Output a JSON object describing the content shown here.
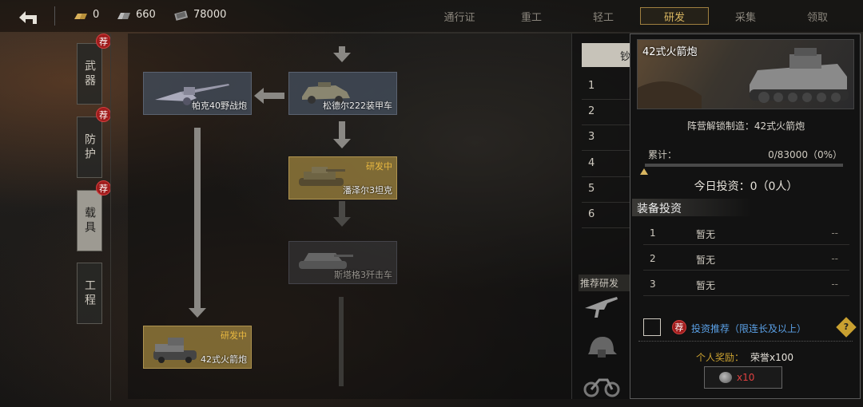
{
  "topbar": {
    "resources": [
      {
        "icon": "gold-bars-icon",
        "value": "0"
      },
      {
        "icon": "steel-icon",
        "value": "660"
      },
      {
        "icon": "cash-icon",
        "value": "78000"
      }
    ],
    "tabs": [
      "通行证",
      "重工",
      "轻工",
      "研发",
      "采集",
      "领取"
    ],
    "active_tab": "研发"
  },
  "categories": [
    {
      "label": "武器",
      "badge": "荐",
      "active": false
    },
    {
      "label": "防护",
      "badge": "荐",
      "active": false
    },
    {
      "label": "载具",
      "badge": "荐",
      "active": true
    },
    {
      "label": "工程",
      "badge": "",
      "active": false
    }
  ],
  "tree": {
    "nodes": [
      {
        "id": "pak40",
        "label": "帕克40野战炮",
        "status": ""
      },
      {
        "id": "sdkfz222",
        "label": "松德尔222装甲车",
        "status": ""
      },
      {
        "id": "panzer3",
        "label": "潘泽尔3坦克",
        "status": "研发中"
      },
      {
        "id": "stug3",
        "label": "斯塔格3歼击车",
        "status": ""
      },
      {
        "id": "nebelwerfer42",
        "label": "42式火箭炮",
        "status": "研发中"
      }
    ]
  },
  "list_panel": {
    "button_label": "钞",
    "rows": [
      "1",
      "2",
      "3",
      "4",
      "5",
      "6"
    ],
    "recommend_title": "推荐研发",
    "recommend_items": [
      "smg-icon",
      "helmet-icon",
      "motorcycle-icon"
    ]
  },
  "detail": {
    "title": "42式火箭炮",
    "unlock_text": "阵营解锁制造：42式火箭炮",
    "accum_label": "累计：",
    "accum_value": "0/83000（0%）",
    "progress_fraction": 0,
    "today_invest": "今日投资：0（0人）",
    "section_title": "装备投资",
    "invest_rows": [
      {
        "rank": "1",
        "name": "暂无",
        "value": "--"
      },
      {
        "rank": "2",
        "name": "暂无",
        "value": "--"
      },
      {
        "rank": "3",
        "name": "暂无",
        "value": "--"
      }
    ],
    "recommend_badge": "荐",
    "recommend_text": "投资推荐（限连长及以上）",
    "help": "?",
    "reward_label": "个人奖励：",
    "reward_value": "荣誉x100",
    "cost_label": "x10"
  },
  "colors": {
    "accent_gold": "#d8b560",
    "badge_red": "#a01c1c",
    "link_blue": "#5aa0e6",
    "cost_red": "#e04040"
  }
}
